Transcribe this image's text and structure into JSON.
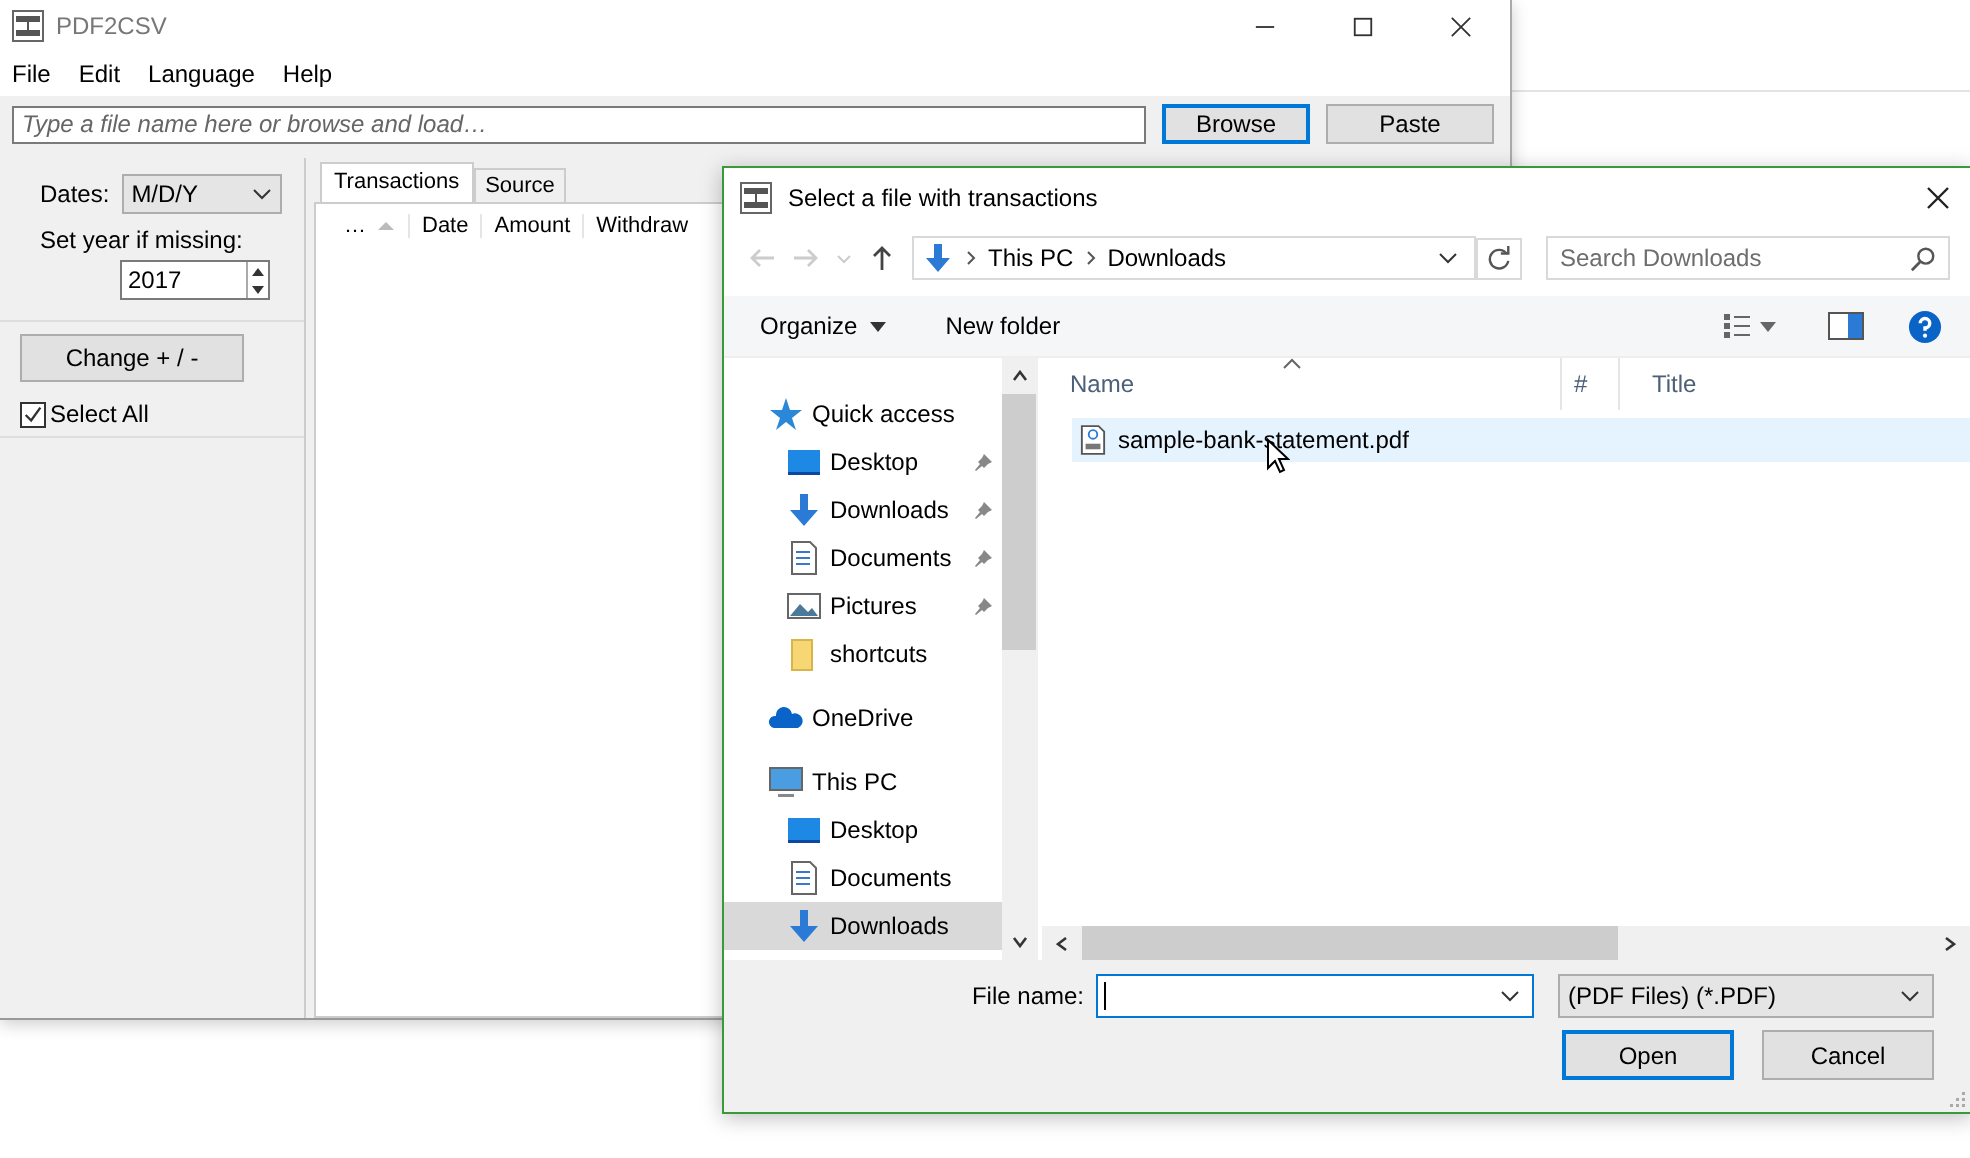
{
  "main_window": {
    "title": "PDF2CSV",
    "menu": [
      "File",
      "Edit",
      "Language",
      "Help"
    ],
    "file_field": {
      "placeholder": "Type a file name here or browse and load…"
    },
    "buttons": [
      {
        "label": "Browse",
        "focused": true
      },
      {
        "label": "Paste",
        "focused": false
      }
    ],
    "dates": {
      "label": "Dates:",
      "value": "M/D/Y"
    },
    "year": {
      "label": "Set year if missing:",
      "value": "2017"
    },
    "change_button": "Change + / -",
    "select_all": {
      "label": "Select All",
      "checked": true
    },
    "tabs": [
      {
        "label": "Transactions",
        "selected": true
      },
      {
        "label": "Source",
        "selected": false
      }
    ],
    "columns": [
      "…",
      "Date",
      "Amount",
      "Withdraw"
    ]
  },
  "dialog": {
    "title": "Select a file with transactions",
    "breadcrumb": [
      "This PC",
      "Downloads"
    ],
    "search": {
      "placeholder": "Search Downloads"
    },
    "toolbar": [
      "Organize",
      "New folder"
    ],
    "nav": [
      {
        "label": "Quick access",
        "kind": "star",
        "selected": false,
        "children": [
          {
            "label": "Desktop",
            "kind": "desktop",
            "pinned": true,
            "selected": false
          },
          {
            "label": "Downloads",
            "kind": "download",
            "pinned": true,
            "selected": false
          },
          {
            "label": "Documents",
            "kind": "document",
            "pinned": true,
            "selected": false
          },
          {
            "label": "Pictures",
            "kind": "picture",
            "pinned": true,
            "selected": false
          },
          {
            "label": "shortcuts",
            "kind": "folder",
            "pinned": false,
            "selected": false
          }
        ]
      },
      {
        "label": "OneDrive",
        "kind": "cloud",
        "selected": false
      },
      {
        "label": "This PC",
        "kind": "pc",
        "selected": false,
        "children": [
          {
            "label": "Desktop",
            "kind": "desktop",
            "pinned": false,
            "selected": false
          },
          {
            "label": "Documents",
            "kind": "document",
            "pinned": false,
            "selected": false
          },
          {
            "label": "Downloads",
            "kind": "download",
            "pinned": false,
            "selected": true
          }
        ]
      }
    ],
    "columns": [
      "Name",
      "#",
      "Title"
    ],
    "files": [
      {
        "name": "sample-bank-statement.pdf",
        "hovered": true
      }
    ],
    "file_name": {
      "label": "File name:"
    },
    "filter": "(PDF Files) (*.PDF)",
    "buttons": [
      {
        "label": "Open",
        "default": true
      },
      {
        "label": "Cancel",
        "default": false
      }
    ]
  }
}
